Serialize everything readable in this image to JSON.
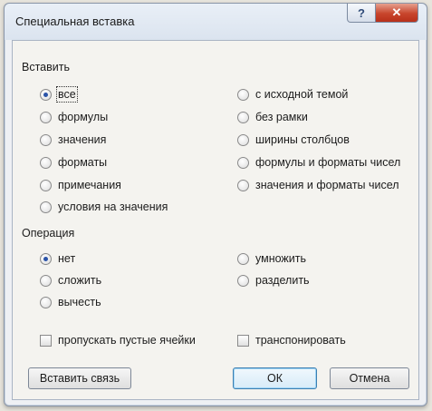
{
  "window": {
    "title": "Специальная вставка",
    "help_glyph": "?",
    "close_glyph": "✕"
  },
  "paste": {
    "label": "Вставить",
    "options_left": [
      {
        "label": "все",
        "selected": true
      },
      {
        "label": "формулы",
        "selected": false
      },
      {
        "label": "значения",
        "selected": false
      },
      {
        "label": "форматы",
        "selected": false
      },
      {
        "label": "примечания",
        "selected": false
      },
      {
        "label": "условия на значения",
        "selected": false
      }
    ],
    "options_right": [
      {
        "label": "с исходной темой",
        "selected": false
      },
      {
        "label": "без рамки",
        "selected": false
      },
      {
        "label": "ширины столбцов",
        "selected": false
      },
      {
        "label": "формулы и форматы чисел",
        "selected": false
      },
      {
        "label": "значения и форматы чисел",
        "selected": false
      }
    ]
  },
  "operation": {
    "label": "Операция",
    "options_left": [
      {
        "label": "нет",
        "selected": true
      },
      {
        "label": "сложить",
        "selected": false
      },
      {
        "label": "вычесть",
        "selected": false
      }
    ],
    "options_right": [
      {
        "label": "умножить",
        "selected": false
      },
      {
        "label": "разделить",
        "selected": false
      }
    ]
  },
  "checks": {
    "skip_blanks": "пропускать пустые ячейки",
    "transpose": "транспонировать"
  },
  "buttons": {
    "paste_link": "Вставить связь",
    "ok": "ОК",
    "cancel": "Отмена"
  },
  "colors": {
    "accent": "#2a53a8",
    "close": "#c8452c"
  }
}
